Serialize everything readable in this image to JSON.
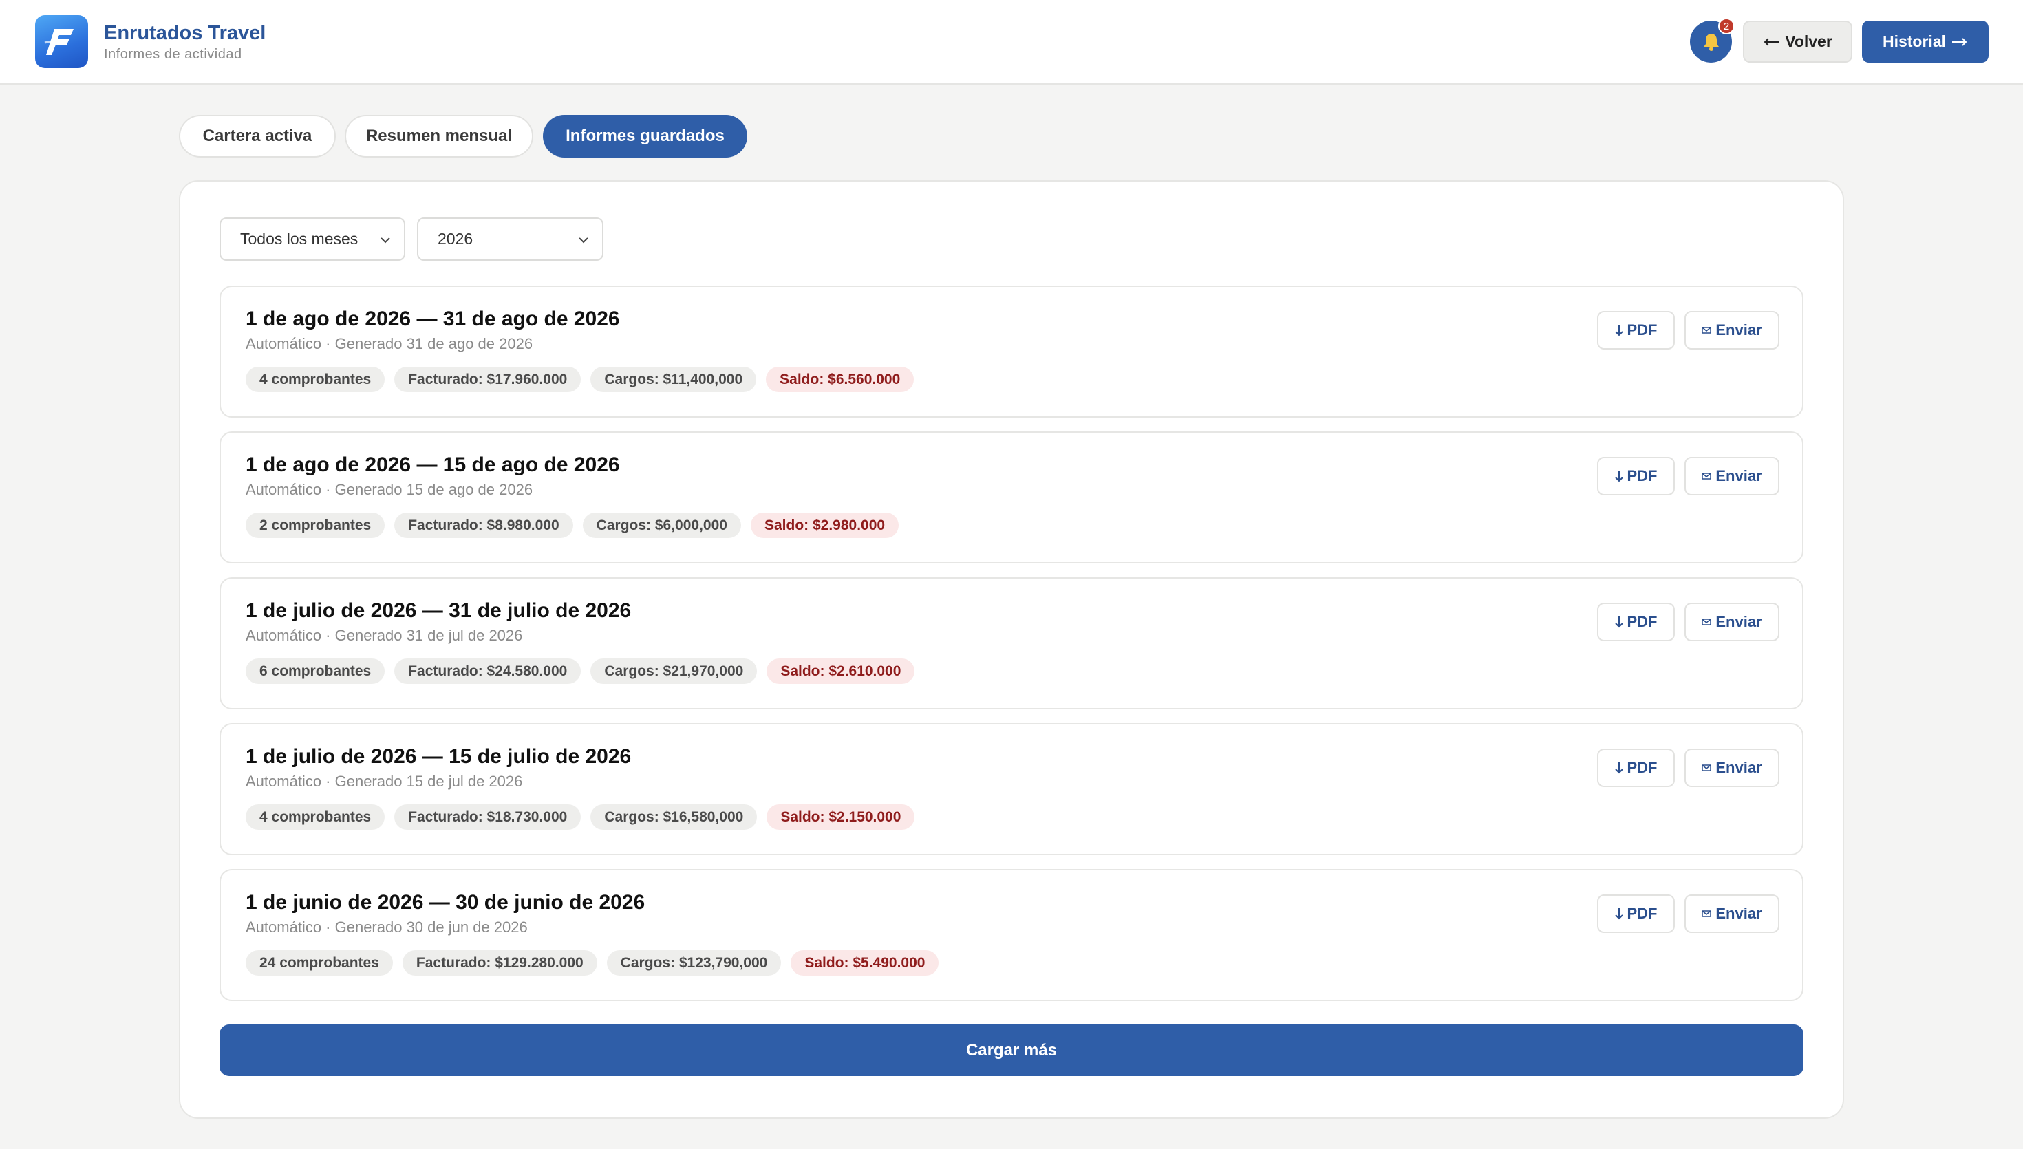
{
  "header": {
    "brand_title": "Enrutados Travel",
    "brand_subtitle": "Informes de actividad",
    "notification_count": "2",
    "back_label": "Volver",
    "history_label": "Historial"
  },
  "tabs": [
    {
      "label": "Cartera activa",
      "active": false
    },
    {
      "label": "Resumen mensual",
      "active": false
    },
    {
      "label": "Informes guardados",
      "active": true
    }
  ],
  "filters": {
    "month": "Todos los meses",
    "year": "2026"
  },
  "reports": [
    {
      "title": "1 de ago de 2026 — 31 de ago de 2026",
      "subtitle": "Automático · Generado 31 de ago de 2026",
      "vouchers": "4 comprobantes",
      "billed": "Facturado: $17.960.000",
      "charges": "Cargos: $11,400,000",
      "balance": "Saldo: $6.560.000"
    },
    {
      "title": "1 de ago de 2026 — 15 de ago de 2026",
      "subtitle": "Automático · Generado 15 de ago de 2026",
      "vouchers": "2 comprobantes",
      "billed": "Facturado: $8.980.000",
      "charges": "Cargos: $6,000,000",
      "balance": "Saldo: $2.980.000"
    },
    {
      "title": "1 de julio de 2026 — 31 de julio de 2026",
      "subtitle": "Automático · Generado 31 de jul de 2026",
      "vouchers": "6 comprobantes",
      "billed": "Facturado: $24.580.000",
      "charges": "Cargos: $21,970,000",
      "balance": "Saldo: $2.610.000"
    },
    {
      "title": "1 de julio de 2026 — 15 de julio de 2026",
      "subtitle": "Automático · Generado 15 de jul de 2026",
      "vouchers": "4 comprobantes",
      "billed": "Facturado: $18.730.000",
      "charges": "Cargos: $16,580,000",
      "balance": "Saldo: $2.150.000"
    },
    {
      "title": "1 de junio de 2026 — 30 de junio de 2026",
      "subtitle": "Automático · Generado 30 de jun de 2026",
      "vouchers": "24 comprobantes",
      "billed": "Facturado: $129.280.000",
      "charges": "Cargos: $123,790,000",
      "balance": "Saldo: $5.490.000"
    }
  ],
  "actions": {
    "pdf_label": "PDF",
    "send_label": "Enviar",
    "load_more_label": "Cargar más"
  },
  "colors": {
    "primary": "#2f5ea8",
    "brand_text": "#2b5599",
    "balance_bg": "#fbe8e8",
    "balance_text": "#8f1c1c",
    "badge": "#c0392b"
  },
  "icons": {
    "logo": "brand-logo-icon",
    "bell": "bell-icon",
    "back": "arrow-left-icon",
    "forward": "arrow-right-icon",
    "download": "arrow-down-icon",
    "mail": "envelope-icon",
    "dropdown": "chevron-down-icon"
  }
}
